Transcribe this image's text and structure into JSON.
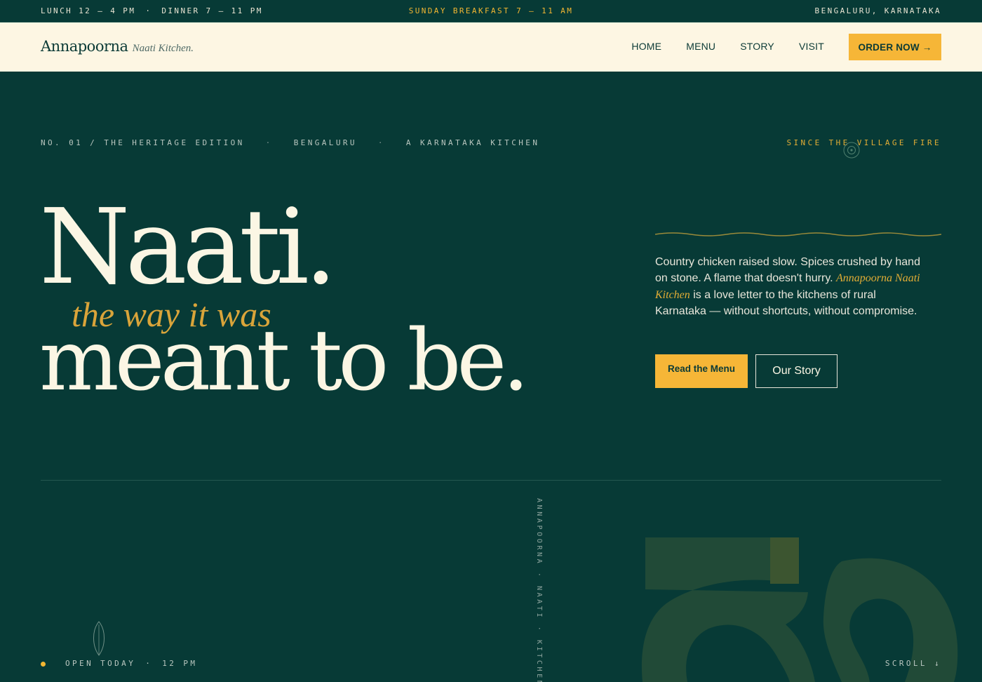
{
  "topbar": {
    "hours_lunch": "LUNCH 12 – 4 PM",
    "hours_sep": "·",
    "hours_dinner": "DINNER 7 – 11 PM",
    "breakfast": "SUNDAY BREAKFAST 7 – 11 AM",
    "location": "BENGALURU, KARNATAKA"
  },
  "nav": {
    "brand_name": "Annapoorna",
    "brand_sub": "Naati Kitchen.",
    "links": [
      "HOME",
      "MENU",
      "STORY",
      "VISIT"
    ],
    "cta": "ORDER NOW →"
  },
  "hero": {
    "meta": {
      "edition": "NO. 01 / THE HERITAGE EDITION",
      "sep": "·",
      "city": "BENGALURU",
      "kitchen": "A KARNATAKA KITCHEN",
      "since": "SINCE THE VILLAGE FIRE"
    },
    "headline_line1": "Naati.",
    "headline_italic": "the way it was",
    "headline_line2": "meant to be.",
    "intro_text_1": "Country chicken raised slow. Spices crushed by hand on stone. A flame that doesn't hurry. ",
    "intro_em": "Annapoorna Naati Kitchen",
    "intro_text_2": " is a love letter to the kitchens of rural Karnataka — without shortcuts, without compromise.",
    "btn_menu": "Read the Menu",
    "btn_story": "Our Story"
  },
  "footer_strip": {
    "vertical_text": "ANNAPOORNA · NAATI · KITCHEN",
    "open_label": "OPEN TODAY",
    "open_sep": "·",
    "open_time": "12 PM",
    "scroll": "SCROLL ↓"
  },
  "colors": {
    "background": "#073a36",
    "cream": "#fdf6e3",
    "accent": "#f6b637"
  },
  "icons": [
    "fire-ring-icon",
    "leaf-icon",
    "wave-divider"
  ]
}
